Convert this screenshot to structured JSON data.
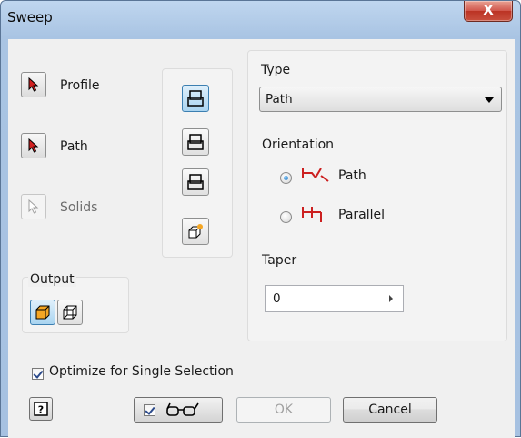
{
  "window": {
    "title": "Sweep",
    "close_label": "X"
  },
  "selection": {
    "profile_label": "Profile",
    "path_label": "Path",
    "solids_label": "Solids"
  },
  "output": {
    "label": "Output"
  },
  "type": {
    "label": "Type",
    "selected": "Path"
  },
  "orientation": {
    "label": "Orientation",
    "options": [
      {
        "label": "Path",
        "checked": true
      },
      {
        "label": "Parallel",
        "checked": false
      }
    ]
  },
  "taper": {
    "label": "Taper",
    "value": "0"
  },
  "optimize": {
    "label": "Optimize for Single Selection",
    "checked": true
  },
  "footer": {
    "ok_label": "OK",
    "cancel_label": "Cancel",
    "preview_checked": true
  },
  "colors": {
    "accent_red": "#cc2020",
    "active_blue": "#3c7fb1",
    "solid_orange": "#f5a623"
  }
}
